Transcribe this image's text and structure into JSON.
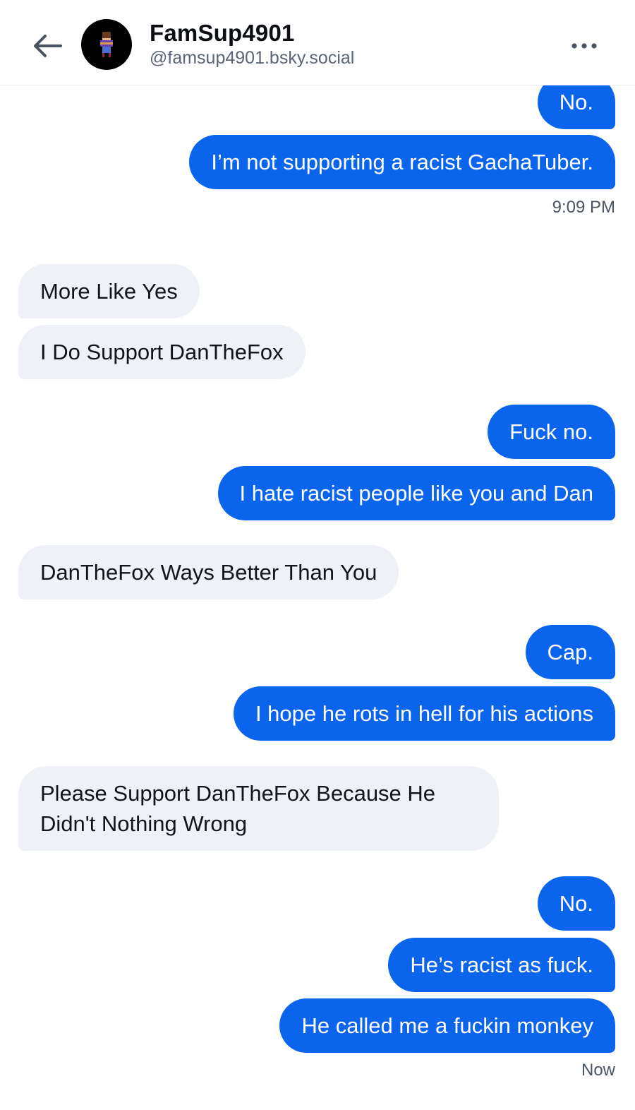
{
  "header": {
    "display_name": "FamSup4901",
    "handle": "@famsup4901.bsky.social",
    "back_icon": "arrow-left-icon",
    "more_icon": "more-horizontal-icon",
    "avatar_icon": "pixel-character-avatar"
  },
  "messages": [
    {
      "from": "me",
      "text": "No."
    },
    {
      "from": "me",
      "text": "I’m not supporting a racist GachaTuber."
    },
    {
      "timestamp": "9:09 PM"
    },
    {
      "from": "them",
      "text": "More Like Yes"
    },
    {
      "from": "them",
      "text": "I Do Support DanTheFox"
    },
    {
      "from": "me",
      "text": "Fuck no."
    },
    {
      "from": "me",
      "text": "I hate racist people like you and Dan"
    },
    {
      "from": "them",
      "text": "DanTheFox Ways Better Than You"
    },
    {
      "from": "me",
      "text": "Cap."
    },
    {
      "from": "me",
      "text": "I hope he rots in hell for his actions"
    },
    {
      "from": "them",
      "text": "Please Support DanTheFox Because He Didn't Nothing Wrong"
    },
    {
      "from": "me",
      "text": "No."
    },
    {
      "from": "me",
      "text": "He’s racist as fuck."
    },
    {
      "from": "me",
      "text": "He called me a fuckin monkey"
    },
    {
      "timestamp": "Now"
    }
  ],
  "colors": {
    "outgoing_bubble": "#0a64ec",
    "incoming_bubble": "#eef1f5",
    "outgoing_text": "#ffffff",
    "incoming_text": "#111418"
  }
}
